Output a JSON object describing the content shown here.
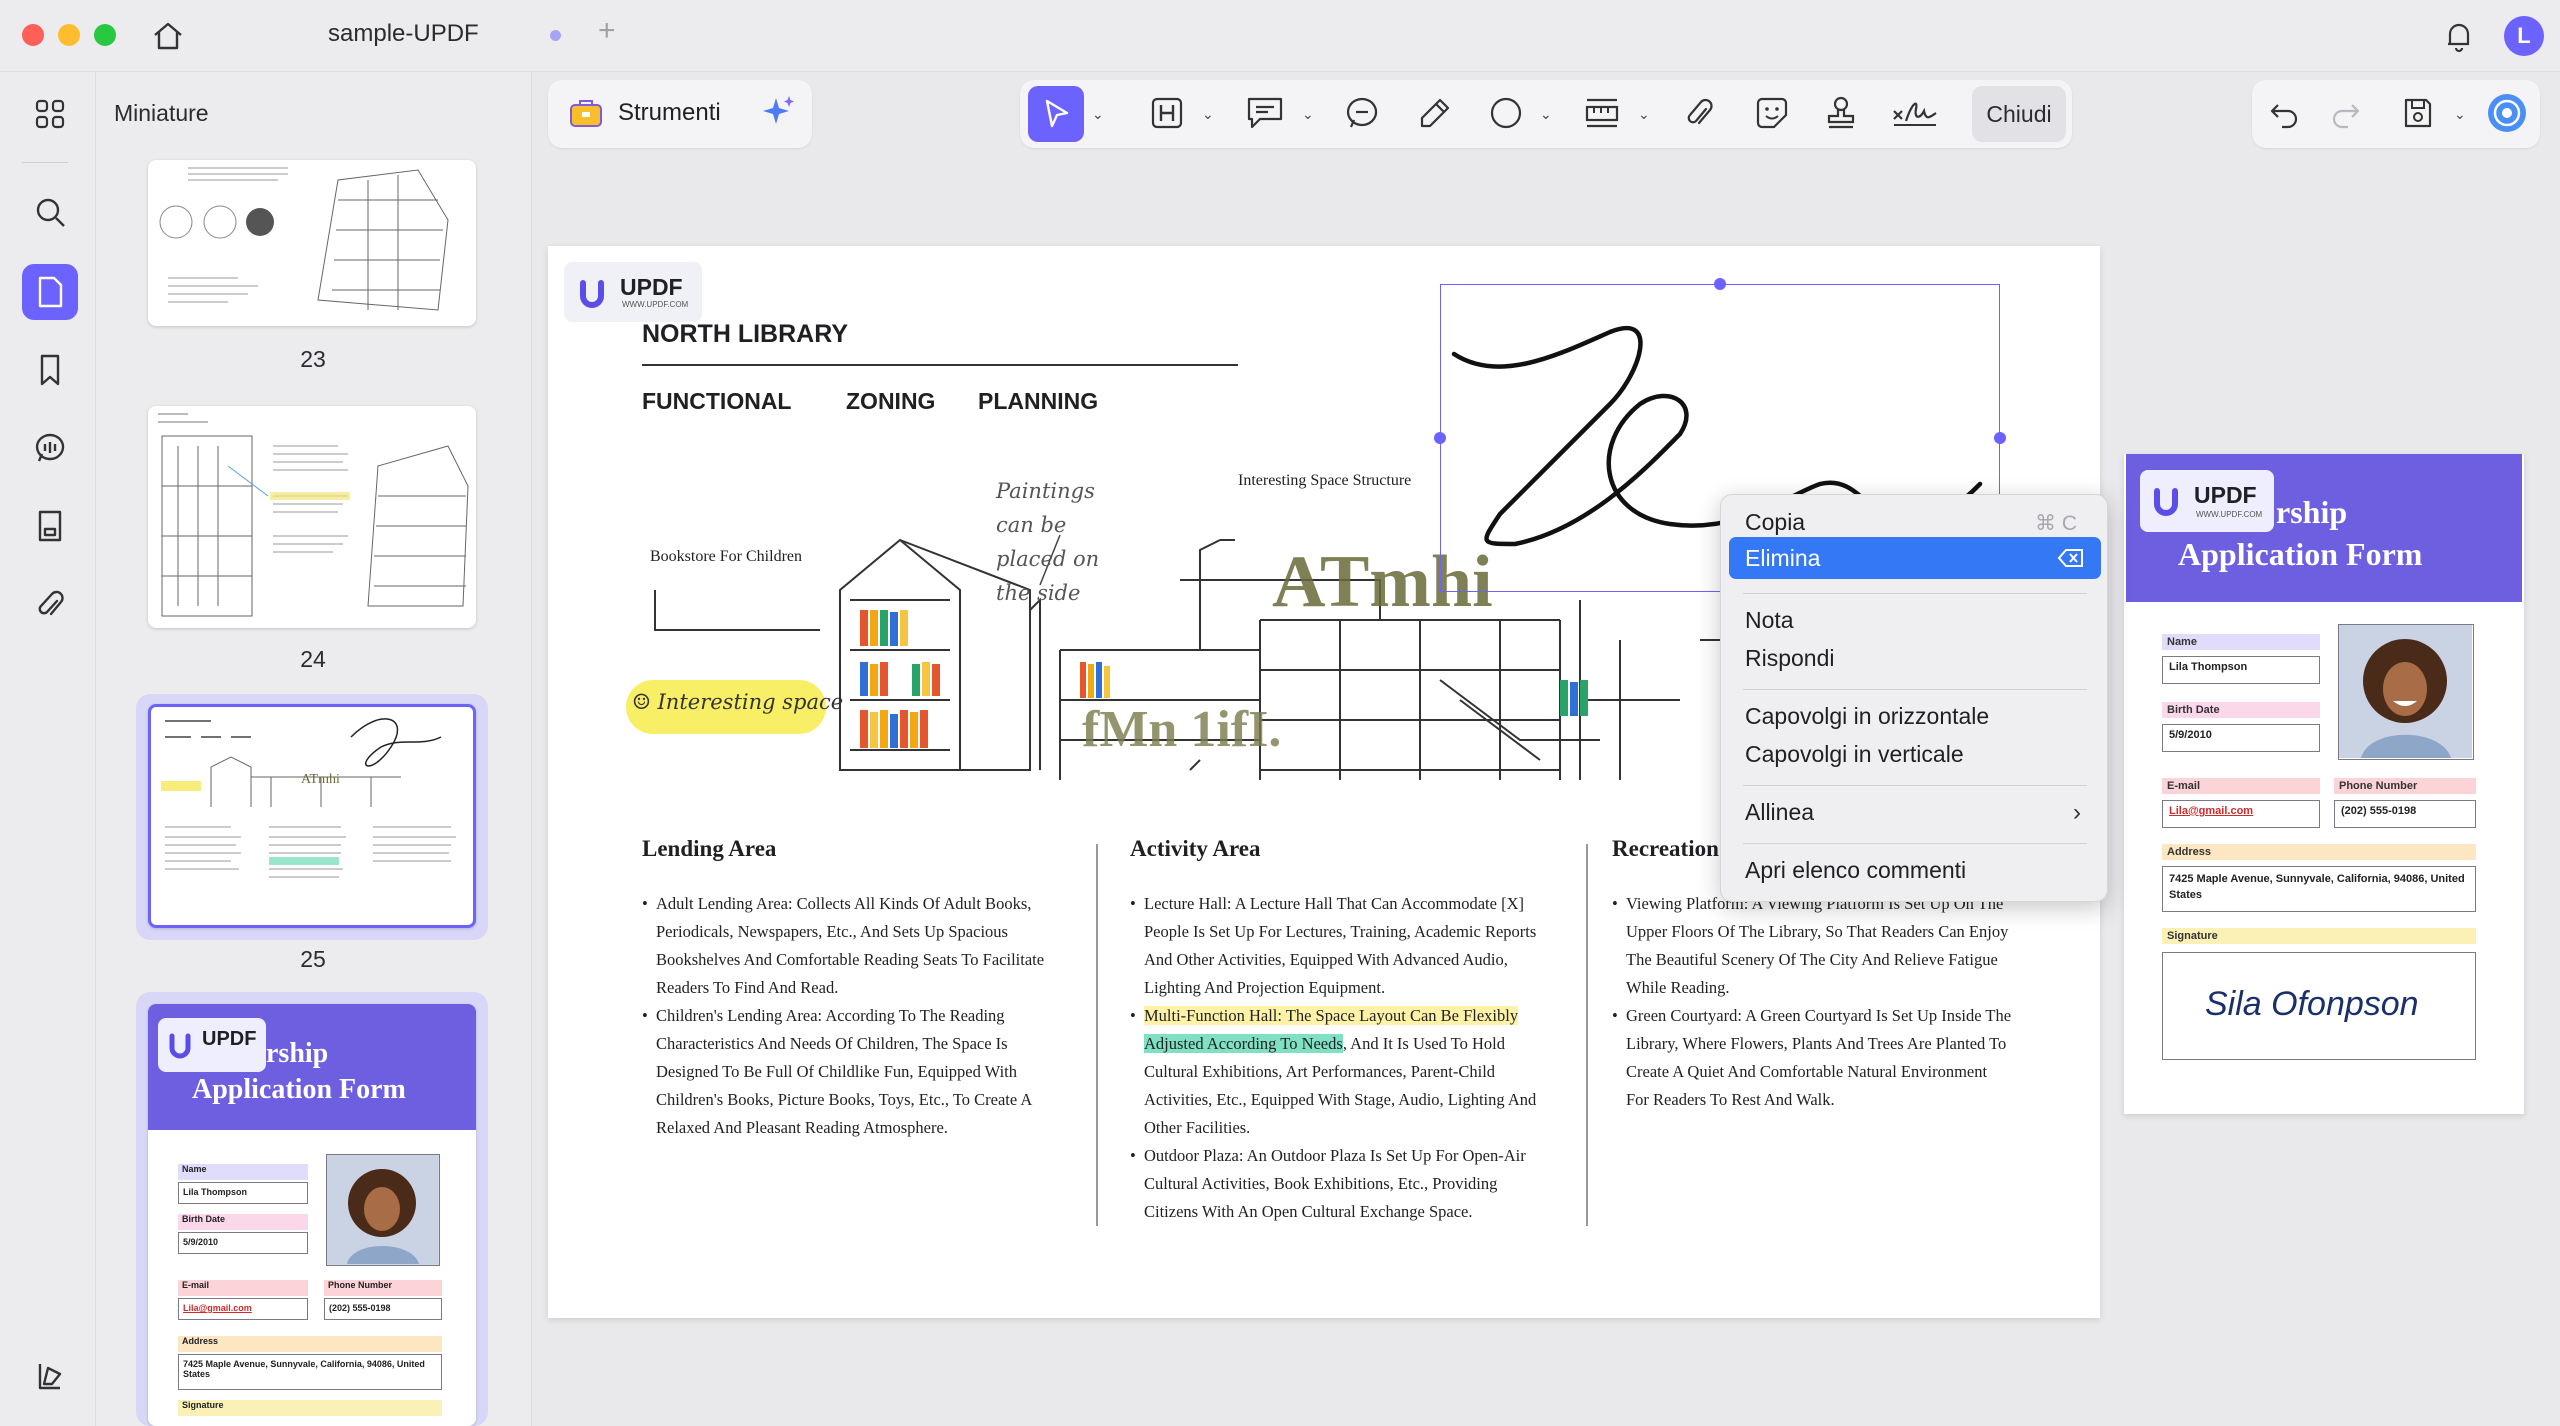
{
  "window": {
    "tab_title": "sample-UPDF",
    "avatar_initial": "L"
  },
  "sidebar": {
    "title": "Miniature",
    "page_numbers": [
      "23",
      "24",
      "25"
    ]
  },
  "toolbar": {
    "tools_label": "Strumenti",
    "close_label": "Chiudi"
  },
  "doc": {
    "logo_text": "UPDF",
    "logo_sub": "WWW.UPDF.COM",
    "title": "NORTH LIBRARY",
    "subtitle": [
      "FUNCTIONAL",
      "ZONING",
      "PLANNING"
    ],
    "annotations": {
      "paintings": "Paintings can be placed on the side",
      "interesting_structure": "Interesting Space Structure",
      "bookstore": "Bookstore For Children",
      "interesting_space": "Interesting space",
      "atmhi": "ATmhi",
      "fmn": "fMn 1ifI."
    },
    "sections": [
      {
        "heading": "Lending Area",
        "items": [
          "Adult Lending Area: Collects All Kinds Of Adult Books, Periodicals, Newspapers, Etc., And Sets Up Spacious Bookshelves And Comfortable Reading Seats To Facilitate Readers To Find And Read.",
          "Children's Lending Area: According To The Reading Characteristics And Needs Of Children, The Space Is Designed To Be Full Of Childlike Fun, Equipped With Children's Books, Picture Books, Toys, Etc., To Create A Relaxed And Pleasant Reading Atmosphere."
        ]
      },
      {
        "heading": "Activity Area",
        "items": [
          "Lecture Hall: A Lecture Hall That Can Accommodate [X] People Is Set Up For Lectures, Training, Academic Reports And Other Activities, Equipped With Advanced Audio, Lighting And Projection Equipment.",
          "Outdoor Plaza: An Outdoor Plaza Is Set Up For Open-Air Cultural Activities, Book Exhibitions, Etc., Providing Citizens With An Open Cultural Exchange Space."
        ],
        "highlight_item": {
          "yellow": "Multi-Function Hall: The Space Layout Can Be Flexibly",
          "green": "Adjusted According To Needs",
          "rest": ", And It Is Used To Hold Cultural Exhibitions, Art Performances, Parent-Child Activities, Etc., Equipped With Stage, Audio, Lighting And Other Facilities."
        }
      },
      {
        "heading": "Recreation",
        "items": [
          "Viewing Platform: A Viewing Platform Is Set Up On The Upper Floors Of The Library, So That Readers Can Enjoy The Beautiful Scenery Of The City And Relieve Fatigue While Reading.",
          "Green Courtyard: A Green Courtyard Is Set Up Inside The Library, Where Flowers, Plants And Trees Are Planted To Create A Quiet And Comfortable Natural Environment For Readers To Rest And Walk."
        ]
      }
    ]
  },
  "form": {
    "title_line1": "rship",
    "title_line2": "Application Form",
    "name_label": "Name",
    "name_value": "Lila Thompson",
    "birth_label": "Birth Date",
    "birth_value": "5/9/2010",
    "email_label": "E-mail",
    "email_value": "Lila@gmail.com",
    "phone_label": "Phone Number",
    "phone_value": "(202) 555-0198",
    "address_label": "Address",
    "address_value": "7425 Maple Avenue, Sunnyvale, California, 94086, United States",
    "signature_label": "Signature",
    "signature_value": "Sila Ofonpson"
  },
  "context_menu": {
    "items": [
      "Copia",
      "Elimina",
      "Nota",
      "Rispondi",
      "Capovolgi in orizzontale",
      "Capovolgi in verticale",
      "Allinea",
      "Apri elenco commenti"
    ],
    "copy_shortcut": "⌘ C",
    "selected": "Elimina"
  },
  "colors": {
    "accent": "#6c63ff",
    "menu_selected": "#3478f6",
    "form_banner": "#6d5fe0"
  }
}
